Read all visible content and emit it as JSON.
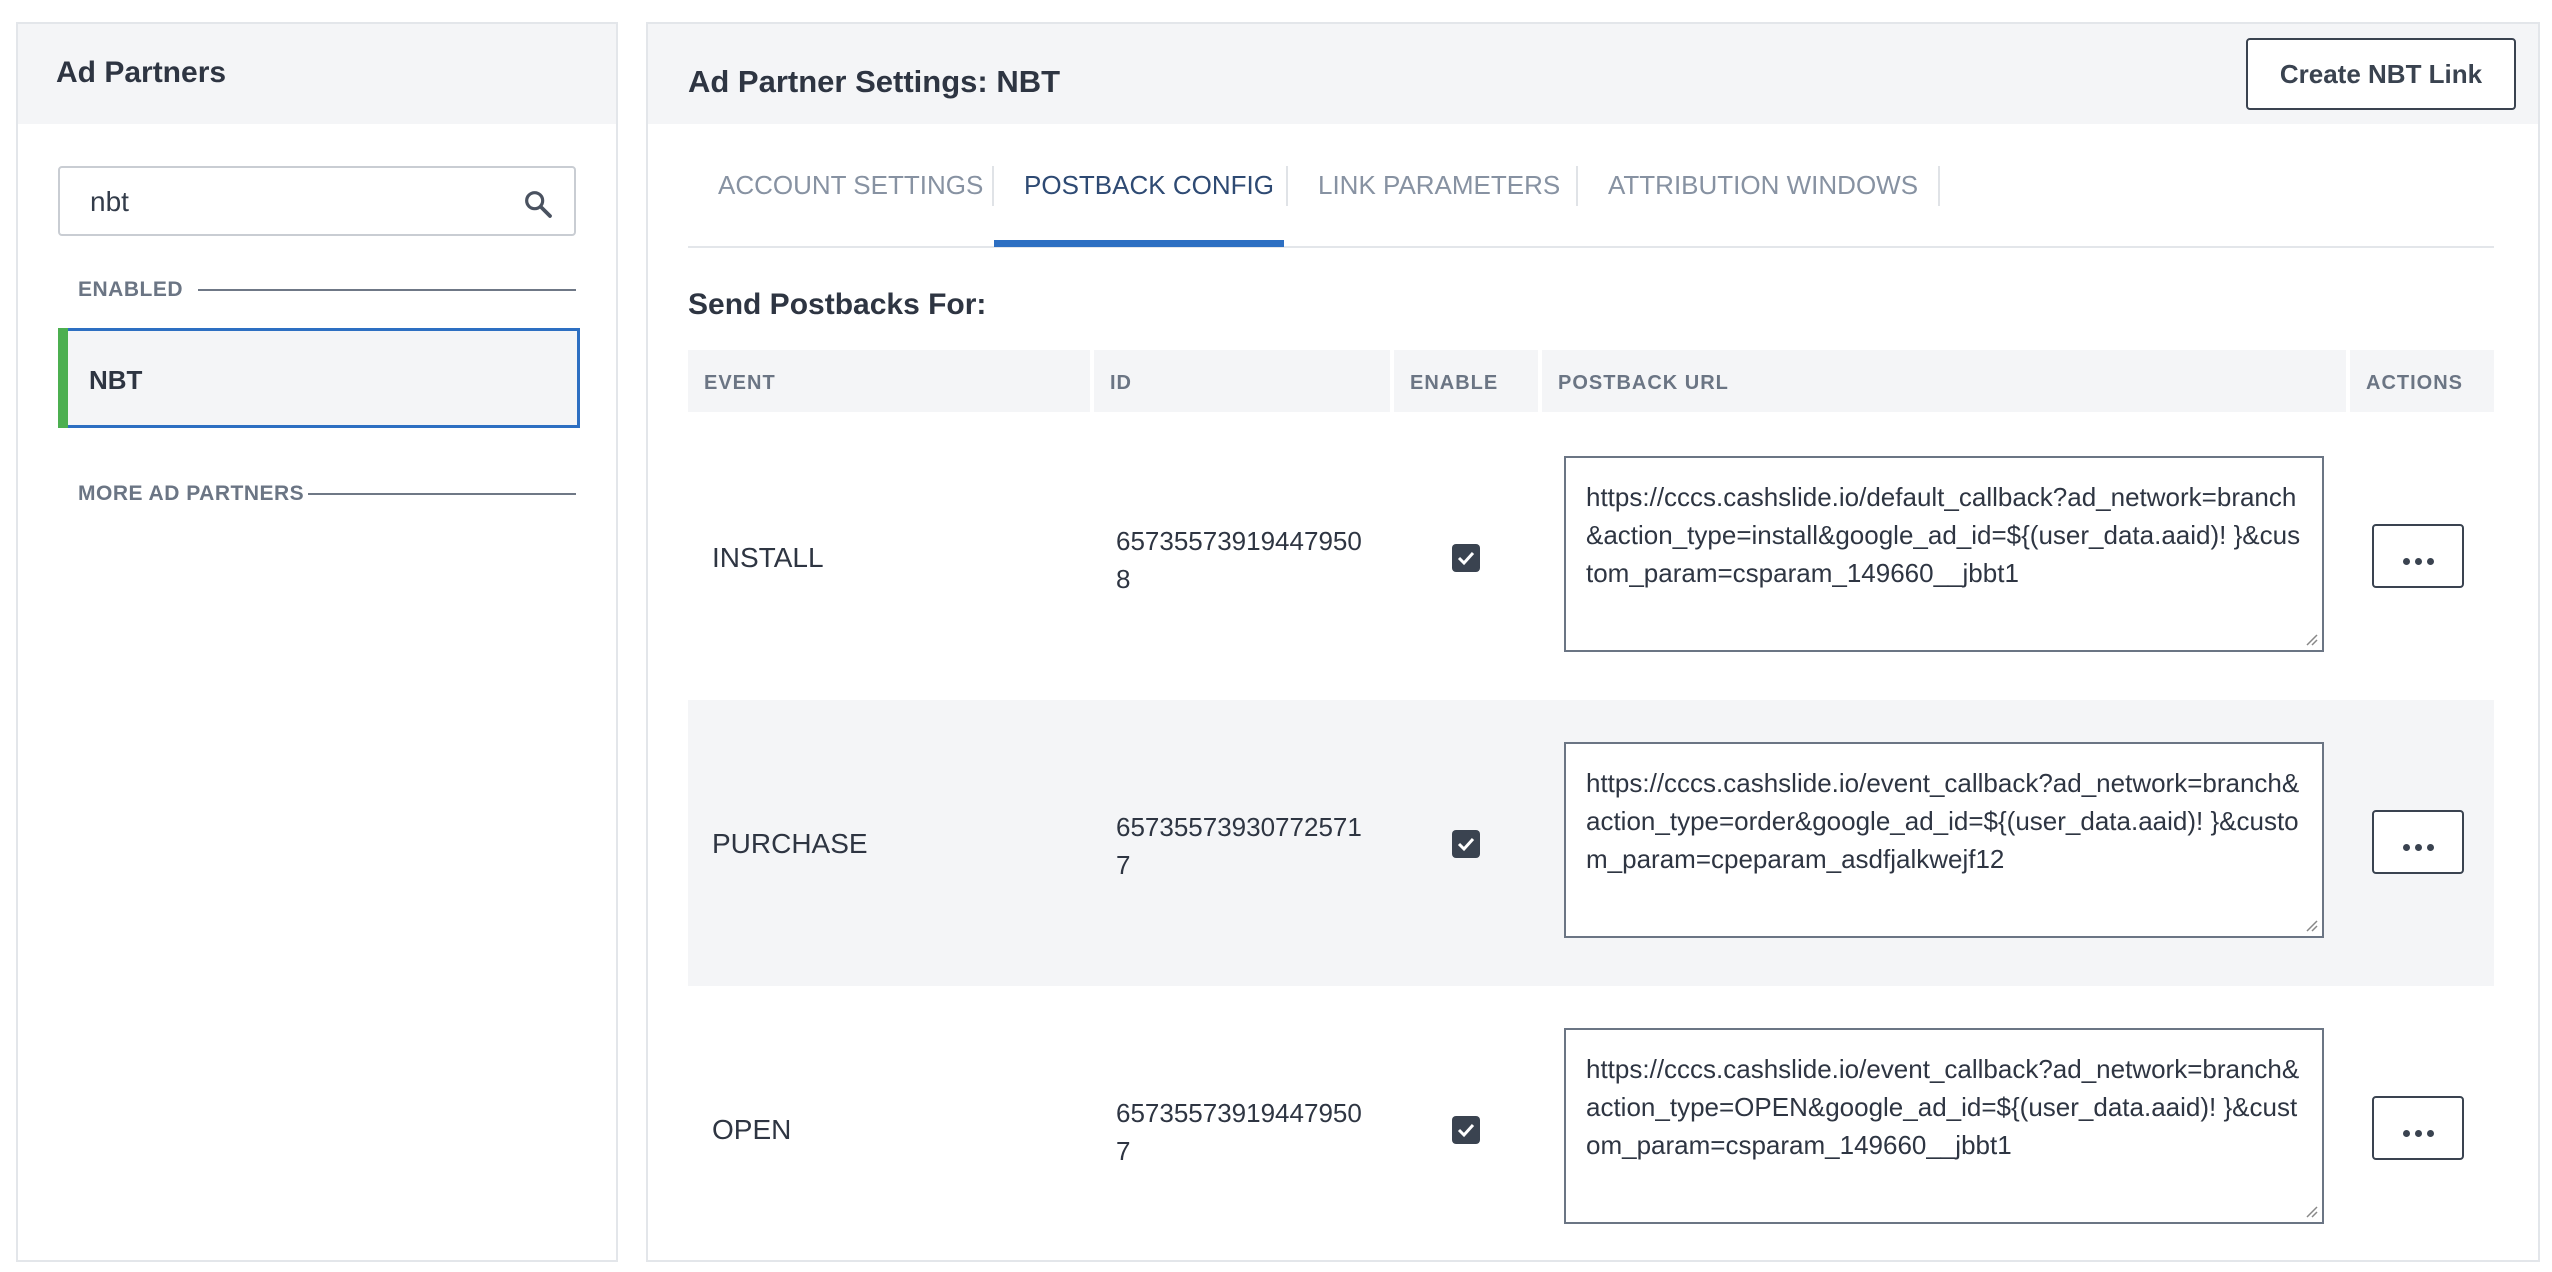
{
  "left": {
    "title": "Ad Partners",
    "search": {
      "value": "nbt",
      "placeholder": ""
    },
    "enabled_label": "ENABLED",
    "partners": [
      {
        "label": "NBT",
        "selected": true,
        "status_color": "#4caf50"
      }
    ],
    "more_label": "MORE AD PARTNERS"
  },
  "main": {
    "title": "Ad Partner Settings: NBT",
    "create_button": "Create NBT Link",
    "tabs": [
      {
        "label": "ACCOUNT SETTINGS",
        "active": false
      },
      {
        "label": "POSTBACK CONFIG",
        "active": true
      },
      {
        "label": "LINK PARAMETERS",
        "active": false
      },
      {
        "label": "ATTRIBUTION WINDOWS",
        "active": false
      }
    ],
    "section_title": "Send Postbacks For:",
    "table": {
      "columns": [
        "EVENT",
        "ID",
        "ENABLE",
        "POSTBACK URL",
        "ACTIONS"
      ],
      "rows": [
        {
          "event": "INSTALL",
          "id": "657355739194479508",
          "enabled": true,
          "url": "https://cccs.cashslide.io/default_callback?ad_network=branch&action_type=install&google_ad_id=${(user_data.aaid)! }&custom_param=csparam_149660__jbbt1"
        },
        {
          "event": "PURCHASE",
          "id": "657355739307725717",
          "enabled": true,
          "url": "https://cccs.cashslide.io/event_callback?ad_network=branch&action_type=order&google_ad_id=${(user_data.aaid)! }&custom_param=cpeparam_asdfjalkwejf12"
        },
        {
          "event": "OPEN",
          "id": "657355739194479507",
          "enabled": true,
          "url": "https://cccs.cashslide.io/event_callback?ad_network=branch&action_type=OPEN&google_ad_id=${(user_data.aaid)! }&custom_param=csparam_149660__jbbt1"
        }
      ]
    }
  },
  "colors": {
    "accent": "#2d6fc2",
    "enabled": "#4caf50",
    "header_bg": "#f4f5f7"
  }
}
